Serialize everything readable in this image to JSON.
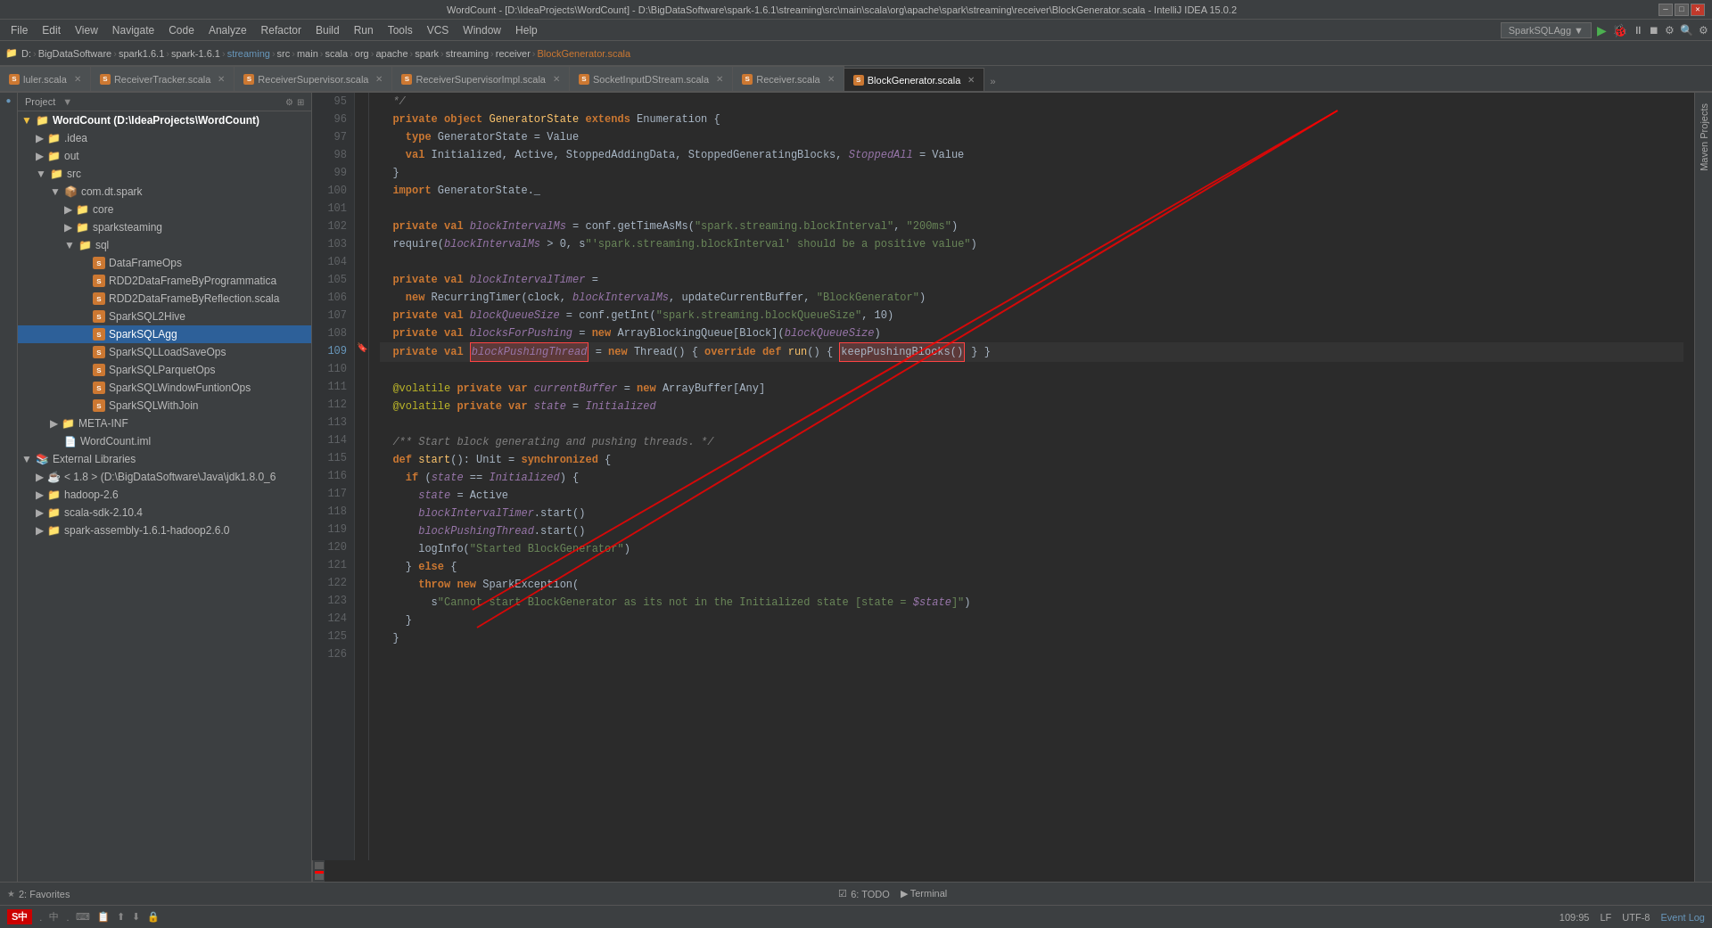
{
  "titleBar": {
    "text": "WordCount - [D:\\IdeaProjects\\WordCount] - D:\\BigDataSoftware\\spark-1.6.1\\streaming\\src\\main\\scala\\org\\apache\\spark\\streaming\\receiver\\BlockGenerator.scala - IntelliJ IDEA 15.0.2",
    "minimize": "—",
    "maximize": "□",
    "close": "✕"
  },
  "menuBar": {
    "items": [
      "File",
      "Edit",
      "View",
      "Navigate",
      "Code",
      "Analyze",
      "Refactor",
      "Build",
      "Run",
      "Tools",
      "VCS",
      "Window",
      "Help"
    ]
  },
  "breadcrumbs": {
    "items": [
      "D:",
      "BigDataSoftware",
      "spark1.6.1",
      "spark-1.6.1",
      "streaming",
      "src",
      "main",
      "scala",
      "org",
      "apache",
      "spark",
      "streaming",
      "receiver",
      "BlockGenerator.scala"
    ]
  },
  "tabs": [
    {
      "label": "luler.scala",
      "active": false,
      "icon": "S"
    },
    {
      "label": "ReceiverTracker.scala",
      "active": false,
      "icon": "S"
    },
    {
      "label": "ReceiverSupervisor.scala",
      "active": false,
      "icon": "S"
    },
    {
      "label": "ReceiverSupervisorImpl.scala",
      "active": false,
      "icon": "S"
    },
    {
      "label": "SocketInputDStream.scala",
      "active": false,
      "icon": "S"
    },
    {
      "label": "Receiver.scala",
      "active": false,
      "icon": "S"
    },
    {
      "label": "BlockGenerator.scala",
      "active": true,
      "icon": "S"
    }
  ],
  "sidebar": {
    "header": "Project",
    "tree": [
      {
        "indent": 0,
        "arrow": "▼",
        "icon": "folder",
        "label": "WordCount (D:\\IdeaProjects\\WordCount)",
        "bold": true,
        "level": 0
      },
      {
        "indent": 1,
        "arrow": "▶",
        "icon": "folder",
        "label": ".idea",
        "level": 1
      },
      {
        "indent": 1,
        "arrow": "▶",
        "icon": "folder",
        "label": "out",
        "level": 1
      },
      {
        "indent": 1,
        "arrow": "▼",
        "icon": "folder",
        "label": "src",
        "level": 1
      },
      {
        "indent": 2,
        "arrow": "▼",
        "icon": "folder",
        "label": "com.dt.spark",
        "level": 2
      },
      {
        "indent": 3,
        "arrow": "▶",
        "icon": "folder",
        "label": "core",
        "level": 3
      },
      {
        "indent": 3,
        "arrow": "▶",
        "icon": "folder",
        "label": "sparksteaming",
        "level": 3
      },
      {
        "indent": 3,
        "arrow": "▼",
        "icon": "folder",
        "label": "sql",
        "level": 3
      },
      {
        "indent": 4,
        "arrow": "",
        "icon": "scala",
        "label": "DataFrameOps",
        "level": 4
      },
      {
        "indent": 4,
        "arrow": "",
        "icon": "scala",
        "label": "RDD2DataFrameByProgrammatica",
        "level": 4
      },
      {
        "indent": 4,
        "arrow": "",
        "icon": "scala",
        "label": "RDD2DataFrameByReflection.scala",
        "level": 4
      },
      {
        "indent": 4,
        "arrow": "",
        "icon": "scala",
        "label": "SparkSQL2Hive",
        "level": 4
      },
      {
        "indent": 4,
        "arrow": "",
        "icon": "scala",
        "label": "SparkSQLAgg",
        "level": 4,
        "selected": true
      },
      {
        "indent": 4,
        "arrow": "",
        "icon": "scala",
        "label": "SparkSQLLoadSaveOps",
        "level": 4
      },
      {
        "indent": 4,
        "arrow": "",
        "icon": "scala",
        "label": "SparkSQLParquetOps",
        "level": 4
      },
      {
        "indent": 4,
        "arrow": "",
        "icon": "scala",
        "label": "SparkSQLWindowFuntionOps",
        "level": 4
      },
      {
        "indent": 4,
        "arrow": "",
        "icon": "scala",
        "label": "SparkSQLWithJoin",
        "level": 4
      },
      {
        "indent": 2,
        "arrow": "▶",
        "icon": "folder",
        "label": "META-INF",
        "level": 2
      },
      {
        "indent": 2,
        "arrow": "",
        "icon": "iml",
        "label": "WordCount.iml",
        "level": 2
      },
      {
        "indent": 0,
        "arrow": "▼",
        "icon": "folder",
        "label": "External Libraries",
        "level": 0
      },
      {
        "indent": 1,
        "arrow": "▶",
        "icon": "folder",
        "label": "< 1.8 > (D:\\BigDataSoftware\\Java\\jdk1.8.0_6",
        "level": 1
      },
      {
        "indent": 1,
        "arrow": "▶",
        "icon": "folder",
        "label": "hadoop-2.6",
        "level": 1
      },
      {
        "indent": 1,
        "arrow": "▶",
        "icon": "folder",
        "label": "scala-sdk-2.10.4",
        "level": 1
      },
      {
        "indent": 1,
        "arrow": "▶",
        "icon": "folder",
        "label": "spark-assembly-1.6.1-hadoop2.6.0",
        "level": 1
      }
    ]
  },
  "toolbar": {
    "project_label": "SparkSQLAgg",
    "run_icon": "▶",
    "debug_icon": "🐛"
  },
  "codeLines": [
    {
      "num": 95,
      "content": "  */"
    },
    {
      "num": 96,
      "content": "  private object GeneratorState extends Enumeration {"
    },
    {
      "num": 97,
      "content": "    type GeneratorState = Value"
    },
    {
      "num": 98,
      "content": "    val Initialized, Active, StoppedAddingData, StoppedGeneratingBlocks, StoppedAll = Value"
    },
    {
      "num": 99,
      "content": "  }"
    },
    {
      "num": 100,
      "content": "  import GeneratorState._"
    },
    {
      "num": 101,
      "content": ""
    },
    {
      "num": 102,
      "content": "  private val blockIntervalMs = conf.getTimeAsMs(\"spark.streaming.blockInterval\", \"200ms\")"
    },
    {
      "num": 103,
      "content": "  require(blockIntervalMs > 0, s\"'spark.streaming.blockInterval' should be a positive value\")"
    },
    {
      "num": 104,
      "content": ""
    },
    {
      "num": 105,
      "content": "  private val blockIntervalTimer ="
    },
    {
      "num": 106,
      "content": "    new RecurringTimer(clock, blockIntervalMs, updateCurrentBuffer, \"BlockGenerator\")"
    },
    {
      "num": 107,
      "content": "  private val blockQueueSize = conf.getInt(\"spark.streaming.blockQueueSize\", 10)"
    },
    {
      "num": 108,
      "content": "  private val blocksForPushing = new ArrayBlockingQueue[Block](blockQueueSize)"
    },
    {
      "num": 109,
      "content": "  private val blockPushingThread = new Thread() { override def run() { keepPushingBlocks() } }"
    },
    {
      "num": 110,
      "content": ""
    },
    {
      "num": 111,
      "content": "  @volatile private var currentBuffer = new ArrayBuffer[Any]"
    },
    {
      "num": 112,
      "content": "  @volatile private var state = Initialized"
    },
    {
      "num": 113,
      "content": ""
    },
    {
      "num": 114,
      "content": "  /** Start block generating and pushing threads. */"
    },
    {
      "num": 115,
      "content": "  def start(): Unit = synchronized {"
    },
    {
      "num": 116,
      "content": "    if (state == Initialized) {"
    },
    {
      "num": 117,
      "content": "      state = Active"
    },
    {
      "num": 118,
      "content": "      blockIntervalTimer.start()"
    },
    {
      "num": 119,
      "content": "      blockPushingThread.start()"
    },
    {
      "num": 120,
      "content": "      logInfo(\"Started BlockGenerator\")"
    },
    {
      "num": 121,
      "content": "    } else {"
    },
    {
      "num": 122,
      "content": "      throw new SparkException("
    },
    {
      "num": 123,
      "content": "        s\"Cannot start BlockGenerator as its not in the Initialized state [state = $state]\")"
    },
    {
      "num": 124,
      "content": "    }"
    },
    {
      "num": 125,
      "content": "  }"
    },
    {
      "num": 126,
      "content": ""
    }
  ],
  "statusBar": {
    "todo": "6: TODO",
    "terminal": "Terminal",
    "event_log": "Event Log",
    "position": "109:95",
    "lf": "LF",
    "encoding": "UTF-8",
    "spark_icon": "S"
  },
  "rightPanel": {
    "label": "Maven Projects"
  },
  "leftPanel": {
    "label": "2: Favorites"
  }
}
